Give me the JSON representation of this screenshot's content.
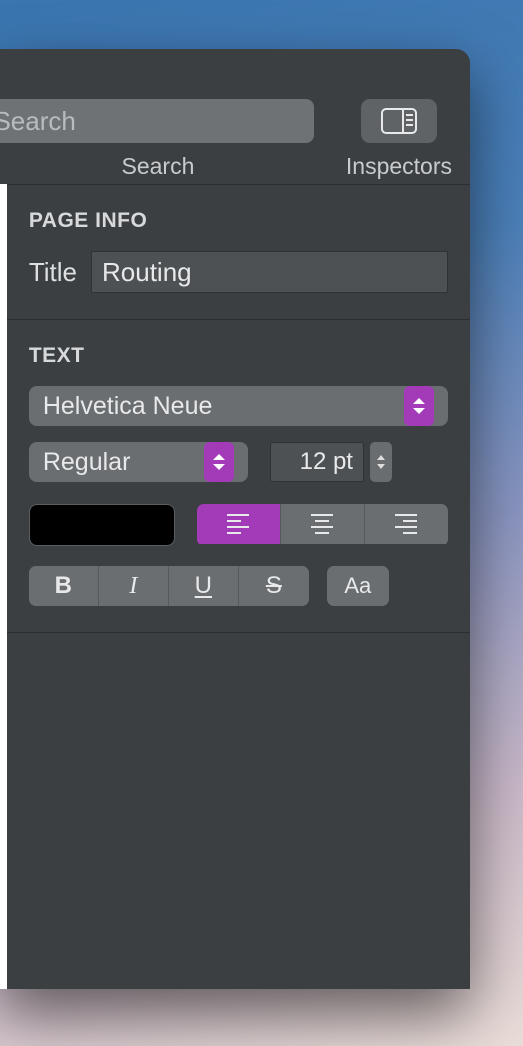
{
  "toolbar": {
    "search_placeholder": "Search",
    "search_label": "Search",
    "inspectors_label": "Inspectors"
  },
  "page_info": {
    "heading": "PAGE INFO",
    "title_label": "Title",
    "title_value": "Routing"
  },
  "text": {
    "heading": "TEXT",
    "font_family": "Helvetica Neue",
    "font_weight": "Regular",
    "font_size": "12 pt",
    "color": "#000000",
    "alignment": "left",
    "bold_label": "B",
    "italic_label": "I",
    "underline_label": "U",
    "strike_label": "S",
    "case_label": "Aa"
  }
}
